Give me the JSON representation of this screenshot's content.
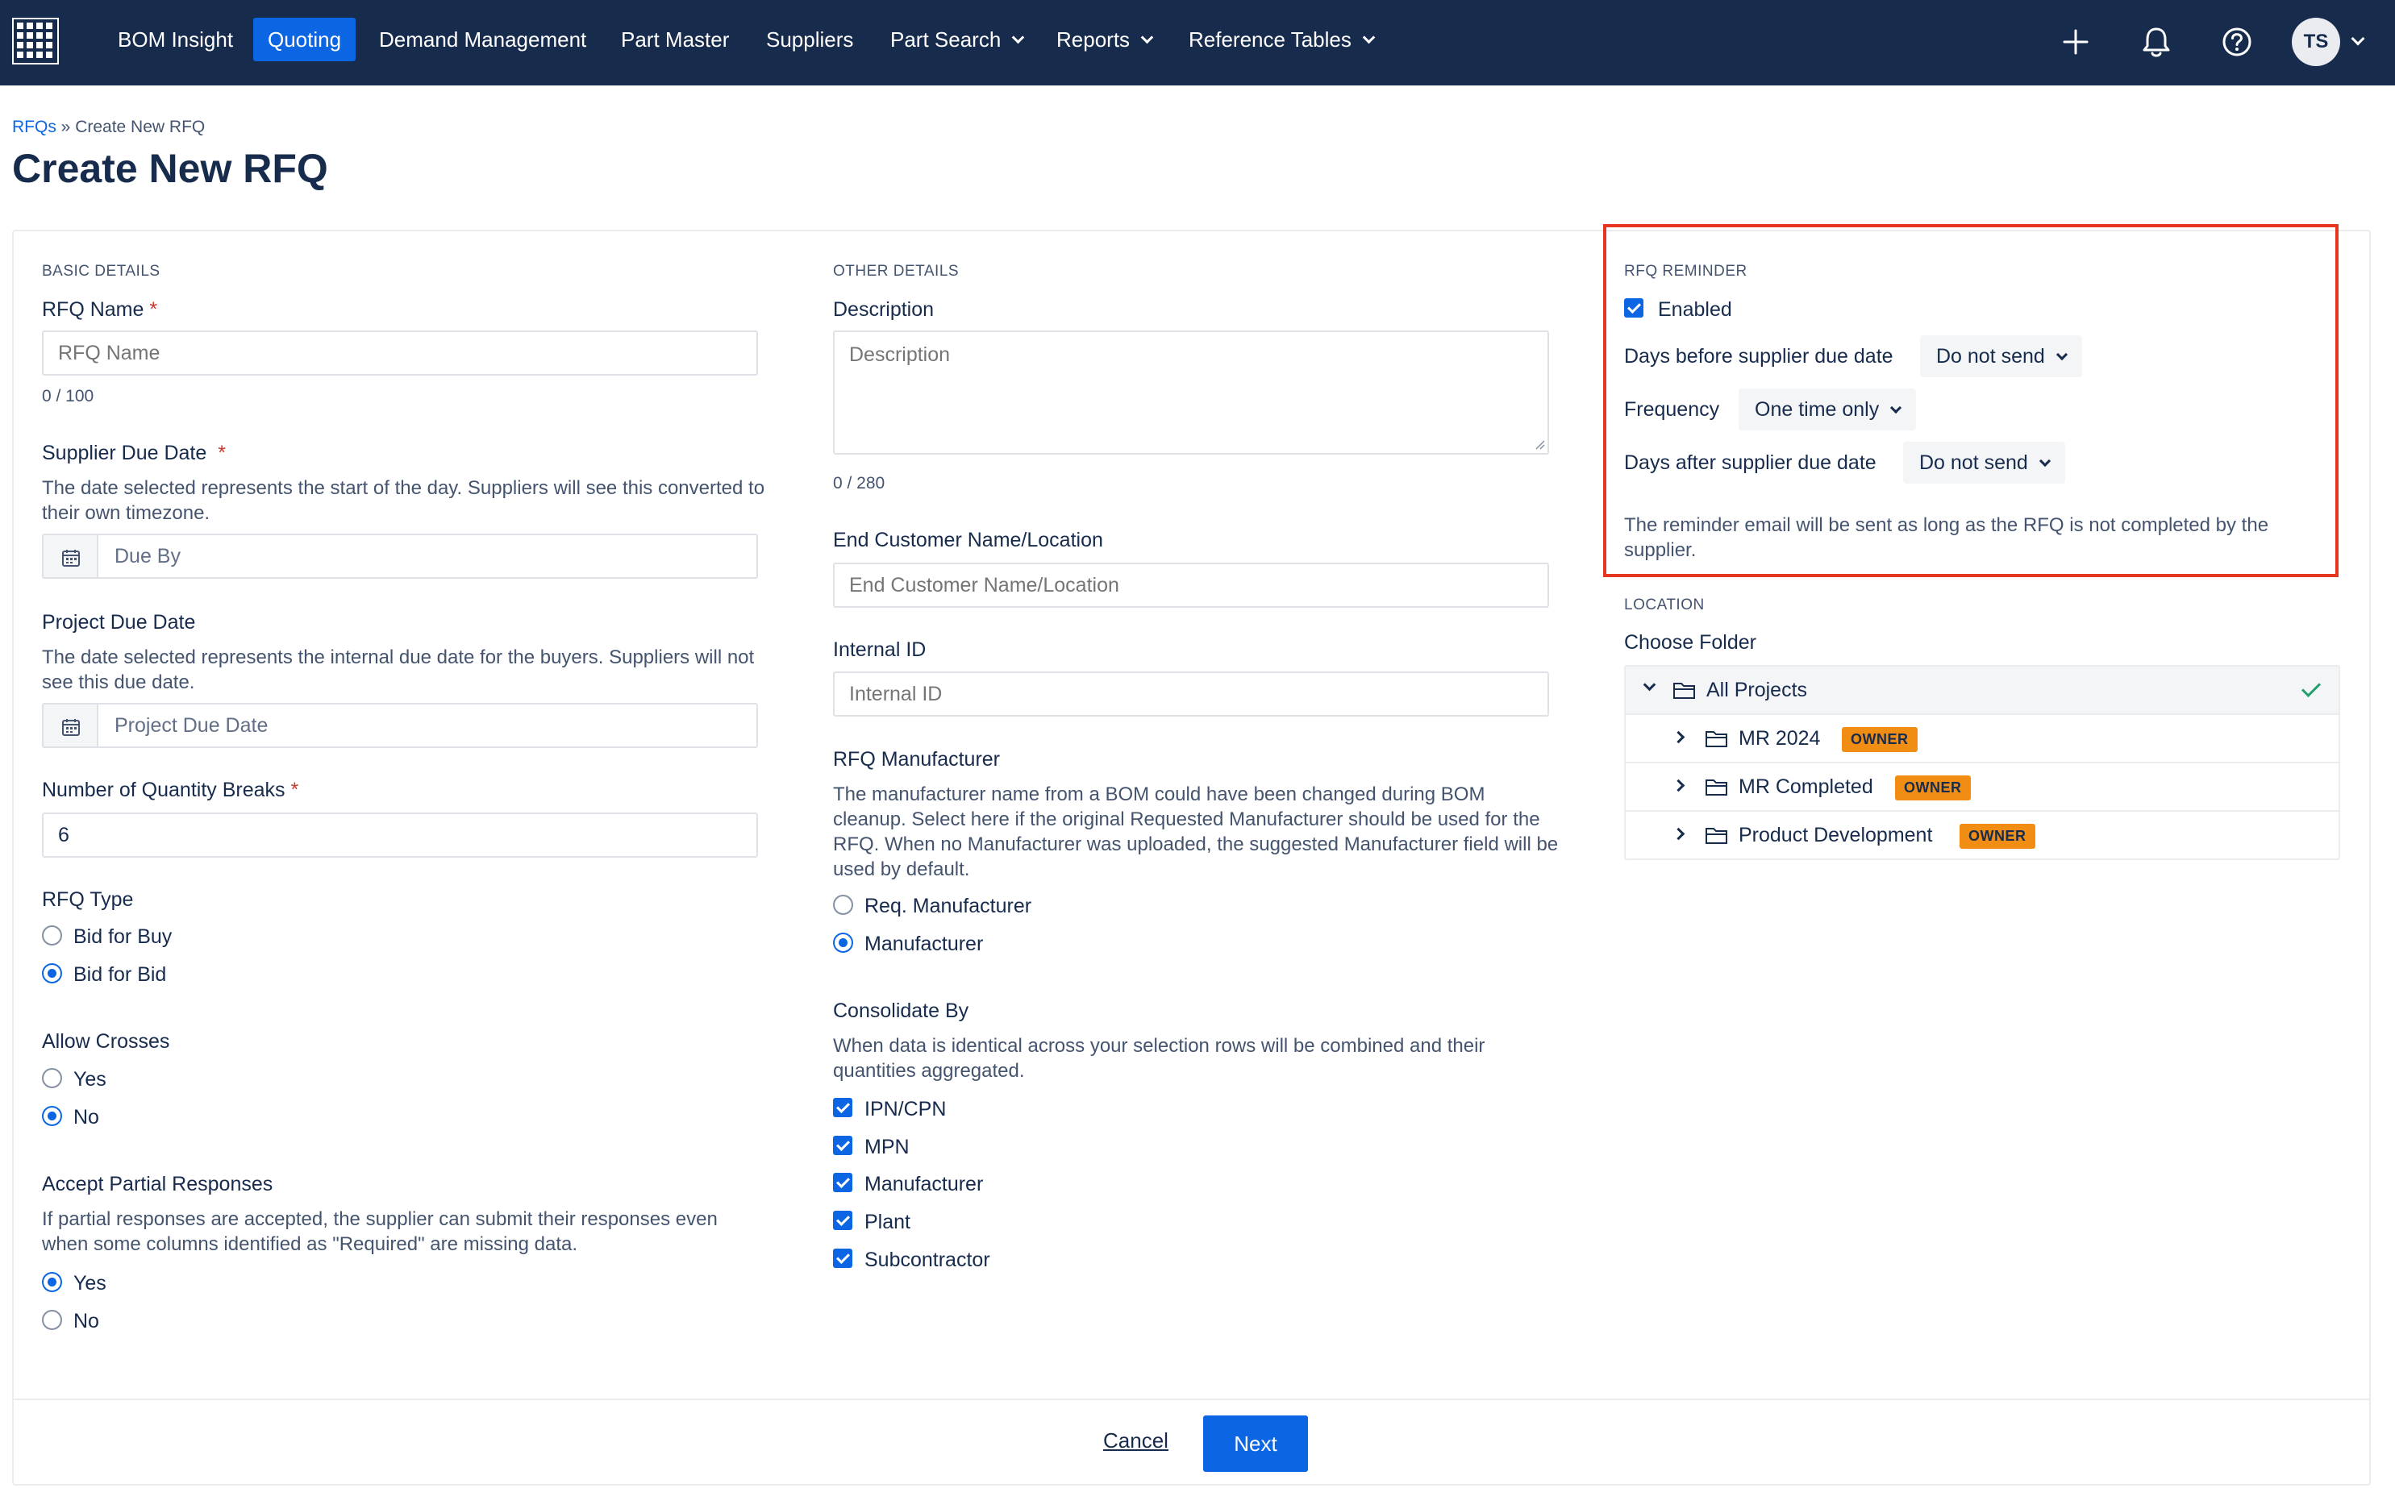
{
  "nav": {
    "items": [
      {
        "label": "BOM Insight"
      },
      {
        "label": "Quoting"
      },
      {
        "label": "Demand Management"
      },
      {
        "label": "Part Master"
      },
      {
        "label": "Suppliers"
      },
      {
        "label": "Part Search"
      },
      {
        "label": "Reports"
      },
      {
        "label": "Reference Tables"
      }
    ],
    "user_initials": "TS"
  },
  "breadcrumb": {
    "parent": "RFQs",
    "separator": " » ",
    "current": "Create New RFQ"
  },
  "page": {
    "title": "Create New RFQ"
  },
  "basic": {
    "heading": "BASIC DETAILS",
    "rfq_name": {
      "label": "RFQ Name",
      "required": "*",
      "placeholder": "RFQ Name",
      "counter": "0 / 100"
    },
    "supplier_due": {
      "label": "Supplier Due Date",
      "required": "*",
      "help": "The date selected represents the start of the day. Suppliers will see this converted to their own timezone.",
      "placeholder": "Due By"
    },
    "project_due": {
      "label": "Project Due Date",
      "help": "The date selected represents the internal due date for the buyers. Suppliers will not see this due date.",
      "placeholder": "Project Due Date"
    },
    "qty_breaks": {
      "label": "Number of Quantity Breaks",
      "required": "*",
      "value": "6"
    },
    "rfq_type": {
      "label": "RFQ Type",
      "options": [
        "Bid for Buy",
        "Bid for Bid"
      ],
      "selected": "Bid for Bid"
    },
    "allow_crosses": {
      "label": "Allow Crosses",
      "options": [
        "Yes",
        "No"
      ],
      "selected": "No"
    },
    "partial": {
      "label": "Accept Partial Responses",
      "help": "If partial responses are accepted, the supplier can submit their responses even when some columns identified as \"Required\" are missing data.",
      "options": [
        "Yes",
        "No"
      ],
      "selected": "Yes"
    }
  },
  "other": {
    "heading": "OTHER DETAILS",
    "description": {
      "label": "Description",
      "placeholder": "Description",
      "counter": "0 / 280"
    },
    "end_customer": {
      "label": "End Customer Name/Location",
      "placeholder": "End Customer Name/Location"
    },
    "internal_id": {
      "label": "Internal ID",
      "placeholder": "Internal ID"
    },
    "manufacturer": {
      "label": "RFQ Manufacturer",
      "help": "The manufacturer name from a BOM could have been changed during BOM cleanup. Select here if the original Requested Manufacturer should be used for the RFQ. When no Manufacturer was uploaded, the suggested Manufacturer field will be used by default.",
      "options": [
        "Req. Manufacturer",
        "Manufacturer"
      ],
      "selected": "Manufacturer"
    },
    "consolidate": {
      "label": "Consolidate By",
      "help": "When data is identical across your selection rows will be combined and their quantities aggregated.",
      "options": [
        "IPN/CPN",
        "MPN",
        "Manufacturer",
        "Plant",
        "Subcontractor"
      ],
      "checked": [
        true,
        true,
        true,
        true,
        true
      ]
    }
  },
  "reminder": {
    "heading": "RFQ REMINDER",
    "enabled_label": "Enabled",
    "enabled": true,
    "days_before": {
      "label": "Days before supplier due date",
      "value": "Do not send"
    },
    "frequency": {
      "label": "Frequency",
      "value": "One time only"
    },
    "days_after": {
      "label": "Days after supplier due date",
      "value": "Do not send"
    },
    "note": "The reminder email will be sent as long as the RFQ is not completed by the supplier."
  },
  "location": {
    "heading": "LOCATION",
    "label": "Choose Folder",
    "root": "All Projects",
    "folders": [
      {
        "name": "MR 2024",
        "badge": "OWNER"
      },
      {
        "name": "MR Completed",
        "badge": "OWNER"
      },
      {
        "name": "Product Development",
        "badge": "OWNER"
      }
    ]
  },
  "footer": {
    "cancel": "Cancel",
    "next": "Next"
  },
  "colors": {
    "nav_bg": "#172b4d",
    "accent": "#0c66e4",
    "badge": "#f18d13",
    "highlight": "#e5371f"
  }
}
